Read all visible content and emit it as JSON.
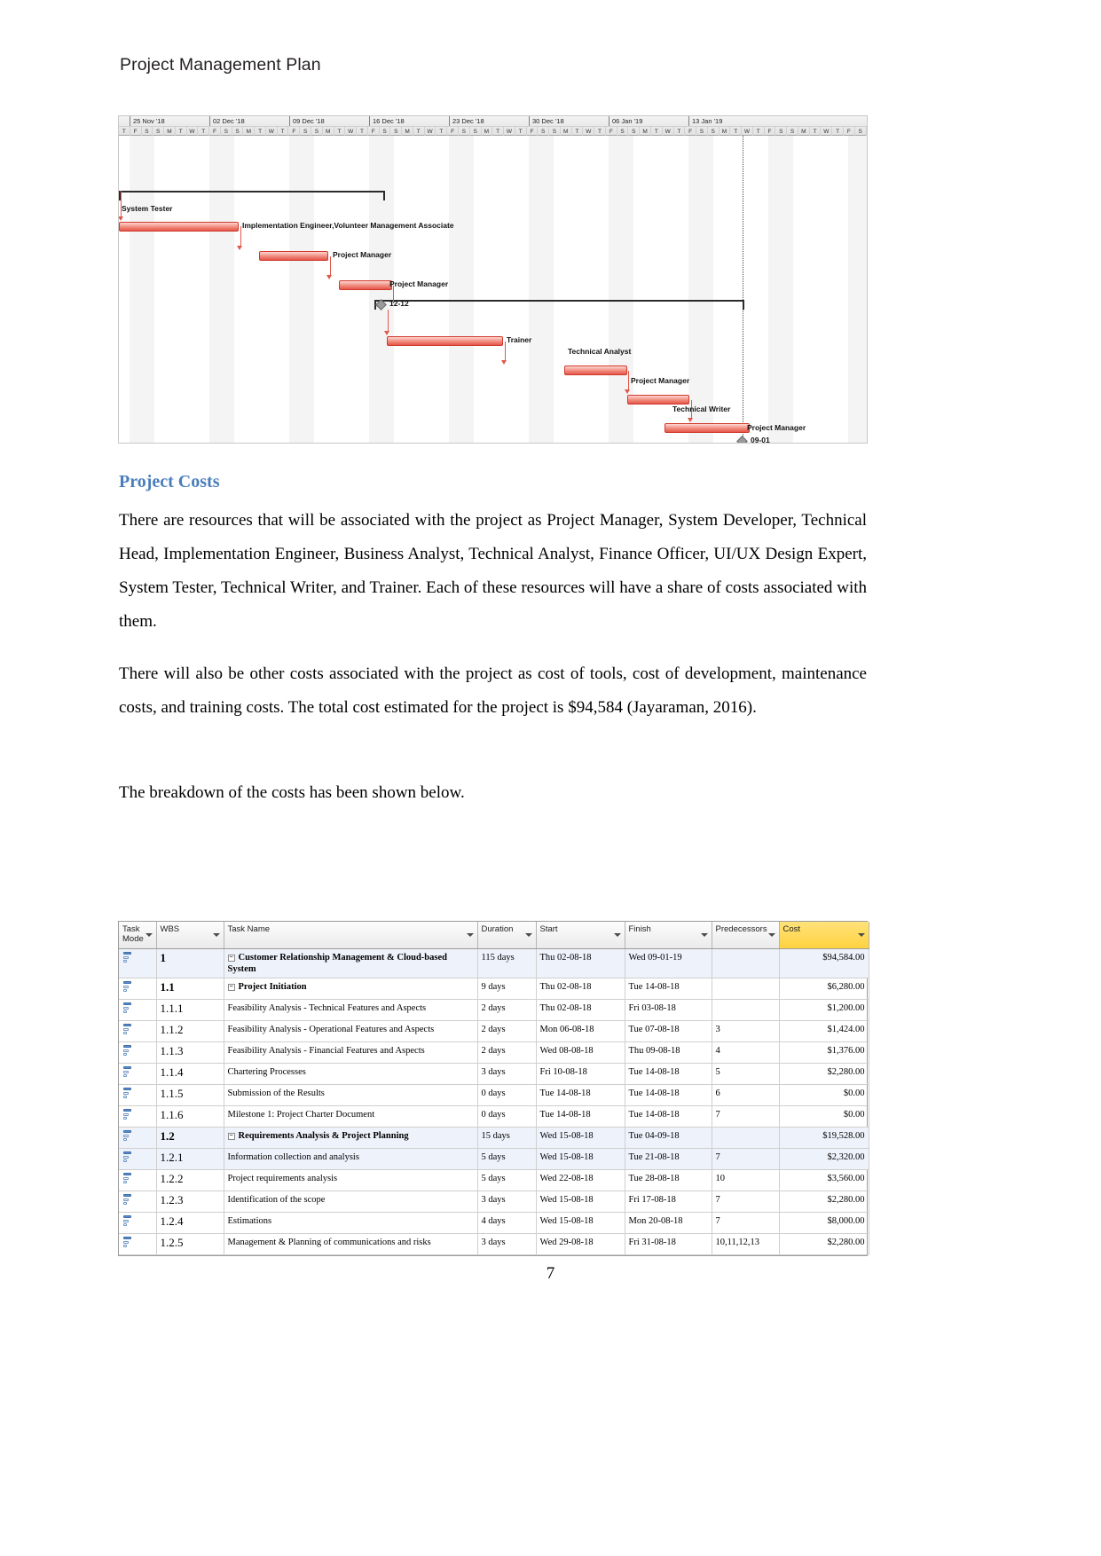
{
  "document": {
    "running_header": "Project Management Plan",
    "page_number": "7"
  },
  "gantt": {
    "week_headers": [
      "25 Nov '18",
      "02 Dec '18",
      "09 Dec '18",
      "16 Dec '18",
      "23 Dec '18",
      "30 Dec '18",
      "06 Jan '19",
      "13 Jan '19"
    ],
    "day_letters": [
      "T",
      "F",
      "S",
      "S",
      "M",
      "T",
      "W",
      "T",
      "F",
      "S",
      "S",
      "M",
      "T",
      "W",
      "T",
      "F",
      "S",
      "S",
      "M",
      "T",
      "W",
      "T",
      "F",
      "S",
      "S",
      "M",
      "T",
      "W",
      "T",
      "F",
      "S",
      "S",
      "M",
      "T",
      "W",
      "T",
      "F",
      "S",
      "S",
      "M",
      "T",
      "W",
      "T",
      "F",
      "S",
      "S",
      "M",
      "T",
      "W",
      "T",
      "F",
      "S",
      "S",
      "M",
      "T",
      "W",
      "T",
      "F",
      "S",
      "S",
      "M",
      "T",
      "W",
      "T",
      "F",
      "S"
    ],
    "bars": [
      {
        "label": "System Tester",
        "label_pos": "above"
      },
      {
        "label": "Implementation Engineer,Volunteer Management Associate",
        "label_pos": "right"
      },
      {
        "label": "Project Manager",
        "label_pos": "right"
      },
      {
        "label": "Project Manager",
        "label_pos": "right"
      },
      {
        "label": "12-12",
        "label_pos": "milestone"
      },
      {
        "label": "Trainer",
        "label_pos": "right"
      },
      {
        "label": "Technical Analyst",
        "label_pos": "right"
      },
      {
        "label": "Project Manager",
        "label_pos": "right"
      },
      {
        "label": "Technical Writer",
        "label_pos": "right"
      },
      {
        "label": "Project Manager",
        "label_pos": "right"
      },
      {
        "label": "09-01",
        "label_pos": "milestone"
      }
    ]
  },
  "section": {
    "heading": "Project Costs",
    "paragraph1": "There are resources that will be associated with the project as Project Manager, System Developer, Technical Head, Implementation Engineer, Business Analyst, Technical Analyst, Finance Officer, UI/UX Design Expert, System Tester, Technical Writer, and Trainer. Each of these resources will have a share of costs associated with them.",
    "paragraph2": "There will also be other costs associated with the project as cost of tools, cost of development, maintenance costs, and training costs. The total cost estimated for the project is $94,584 (Jayaraman, 2016).",
    "paragraph3": "The breakdown of the costs has been shown below."
  },
  "task_table": {
    "columns": [
      "Task Mode",
      "WBS",
      "Task Name",
      "Duration",
      "Start",
      "Finish",
      "Predecessors",
      "Cost"
    ],
    "rows": [
      {
        "wbs": "1",
        "name": "Customer Relationship Management & Cloud-based System",
        "duration": "115 days",
        "start": "Thu 02-08-18",
        "finish": "Wed 09-01-19",
        "predecessors": "",
        "cost": "$94,584.00",
        "level": 0,
        "summary": true,
        "highlight": true
      },
      {
        "wbs": "1.1",
        "name": "Project Initiation",
        "duration": "9 days",
        "start": "Thu 02-08-18",
        "finish": "Tue 14-08-18",
        "predecessors": "",
        "cost": "$6,280.00",
        "level": 1,
        "summary": true,
        "highlight": false
      },
      {
        "wbs": "1.1.1",
        "name": "Feasibility Analysis - Technical Features and Aspects",
        "duration": "2 days",
        "start": "Thu 02-08-18",
        "finish": "Fri 03-08-18",
        "predecessors": "",
        "cost": "$1,200.00",
        "level": 2,
        "summary": false,
        "highlight": false
      },
      {
        "wbs": "1.1.2",
        "name": "Feasibility Analysis - Operational Features and Aspects",
        "duration": "2 days",
        "start": "Mon 06-08-18",
        "finish": "Tue 07-08-18",
        "predecessors": "3",
        "cost": "$1,424.00",
        "level": 2,
        "summary": false,
        "highlight": false
      },
      {
        "wbs": "1.1.3",
        "name": "Feasibility Analysis - Financial Features and Aspects",
        "duration": "2 days",
        "start": "Wed 08-08-18",
        "finish": "Thu 09-08-18",
        "predecessors": "4",
        "cost": "$1,376.00",
        "level": 2,
        "summary": false,
        "highlight": false
      },
      {
        "wbs": "1.1.4",
        "name": "Chartering Processes",
        "duration": "3 days",
        "start": "Fri 10-08-18",
        "finish": "Tue 14-08-18",
        "predecessors": "5",
        "cost": "$2,280.00",
        "level": 2,
        "summary": false,
        "highlight": false
      },
      {
        "wbs": "1.1.5",
        "name": "Submission of the Results",
        "duration": "0 days",
        "start": "Tue 14-08-18",
        "finish": "Tue 14-08-18",
        "predecessors": "6",
        "cost": "$0.00",
        "level": 2,
        "summary": false,
        "highlight": false
      },
      {
        "wbs": "1.1.6",
        "name": "Milestone 1: Project Charter Document",
        "duration": "0 days",
        "start": "Tue 14-08-18",
        "finish": "Tue 14-08-18",
        "predecessors": "7",
        "cost": "$0.00",
        "level": 2,
        "summary": false,
        "highlight": false
      },
      {
        "wbs": "1.2",
        "name": "Requirements Analysis & Project Planning",
        "duration": "15 days",
        "start": "Wed 15-08-18",
        "finish": "Tue 04-09-18",
        "predecessors": "",
        "cost": "$19,528.00",
        "level": 1,
        "summary": true,
        "highlight": true
      },
      {
        "wbs": "1.2.1",
        "name": "Information collection and analysis",
        "duration": "5 days",
        "start": "Wed 15-08-18",
        "finish": "Tue 21-08-18",
        "predecessors": "7",
        "cost": "$2,320.00",
        "level": 2,
        "summary": false,
        "highlight": true
      },
      {
        "wbs": "1.2.2",
        "name": "Project requirements analysis",
        "duration": "5 days",
        "start": "Wed 22-08-18",
        "finish": "Tue 28-08-18",
        "predecessors": "10",
        "cost": "$3,560.00",
        "level": 2,
        "summary": false,
        "highlight": false
      },
      {
        "wbs": "1.2.3",
        "name": "Identification of the scope",
        "duration": "3 days",
        "start": "Wed 15-08-18",
        "finish": "Fri 17-08-18",
        "predecessors": "7",
        "cost": "$2,280.00",
        "level": 2,
        "summary": false,
        "highlight": false
      },
      {
        "wbs": "1.2.4",
        "name": "Estimations",
        "duration": "4 days",
        "start": "Wed 15-08-18",
        "finish": "Mon 20-08-18",
        "predecessors": "7",
        "cost": "$8,000.00",
        "level": 2,
        "summary": false,
        "highlight": false
      },
      {
        "wbs": "1.2.5",
        "name": "Management & Planning of communications and risks",
        "duration": "3 days",
        "start": "Wed 29-08-18",
        "finish": "Fri 31-08-18",
        "predecessors": "10,11,12,13",
        "cost": "$2,280.00",
        "level": 2,
        "summary": false,
        "highlight": false
      }
    ]
  },
  "colors": {
    "heading_blue": "#4a7ebb",
    "bar_red": "#e4564a",
    "cost_header_yellow": "#ffd23f",
    "highlight_blue": "#eef2fb"
  }
}
